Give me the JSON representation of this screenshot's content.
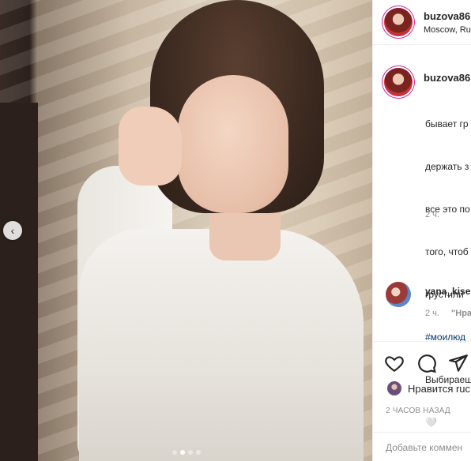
{
  "header": {
    "username": "buzova86",
    "location": "Moscow, Ru"
  },
  "caption": {
    "username": "buzova86",
    "lines": [
      "бывает гр",
      "держать з",
      "все это по",
      "того, чтоб",
      "грустили",
      "#моилюд",
      "Выбираеш",
      "🤍"
    ],
    "time": "2 ч."
  },
  "comment": {
    "username": "yana_kise",
    "time": "2 ч.",
    "reply": "\"Нра"
  },
  "actions": {
    "likes_text": "Нравится ruc",
    "post_time": "2 ЧАСОВ НАЗАД",
    "comment_placeholder": "Добавьте коммен"
  },
  "carousel": {
    "prev_glyph": "‹",
    "slide_count": 4,
    "active_index": 1
  },
  "colors": {
    "link": "#00376b",
    "muted": "#8e8e8e",
    "ring": "#d6249f"
  }
}
